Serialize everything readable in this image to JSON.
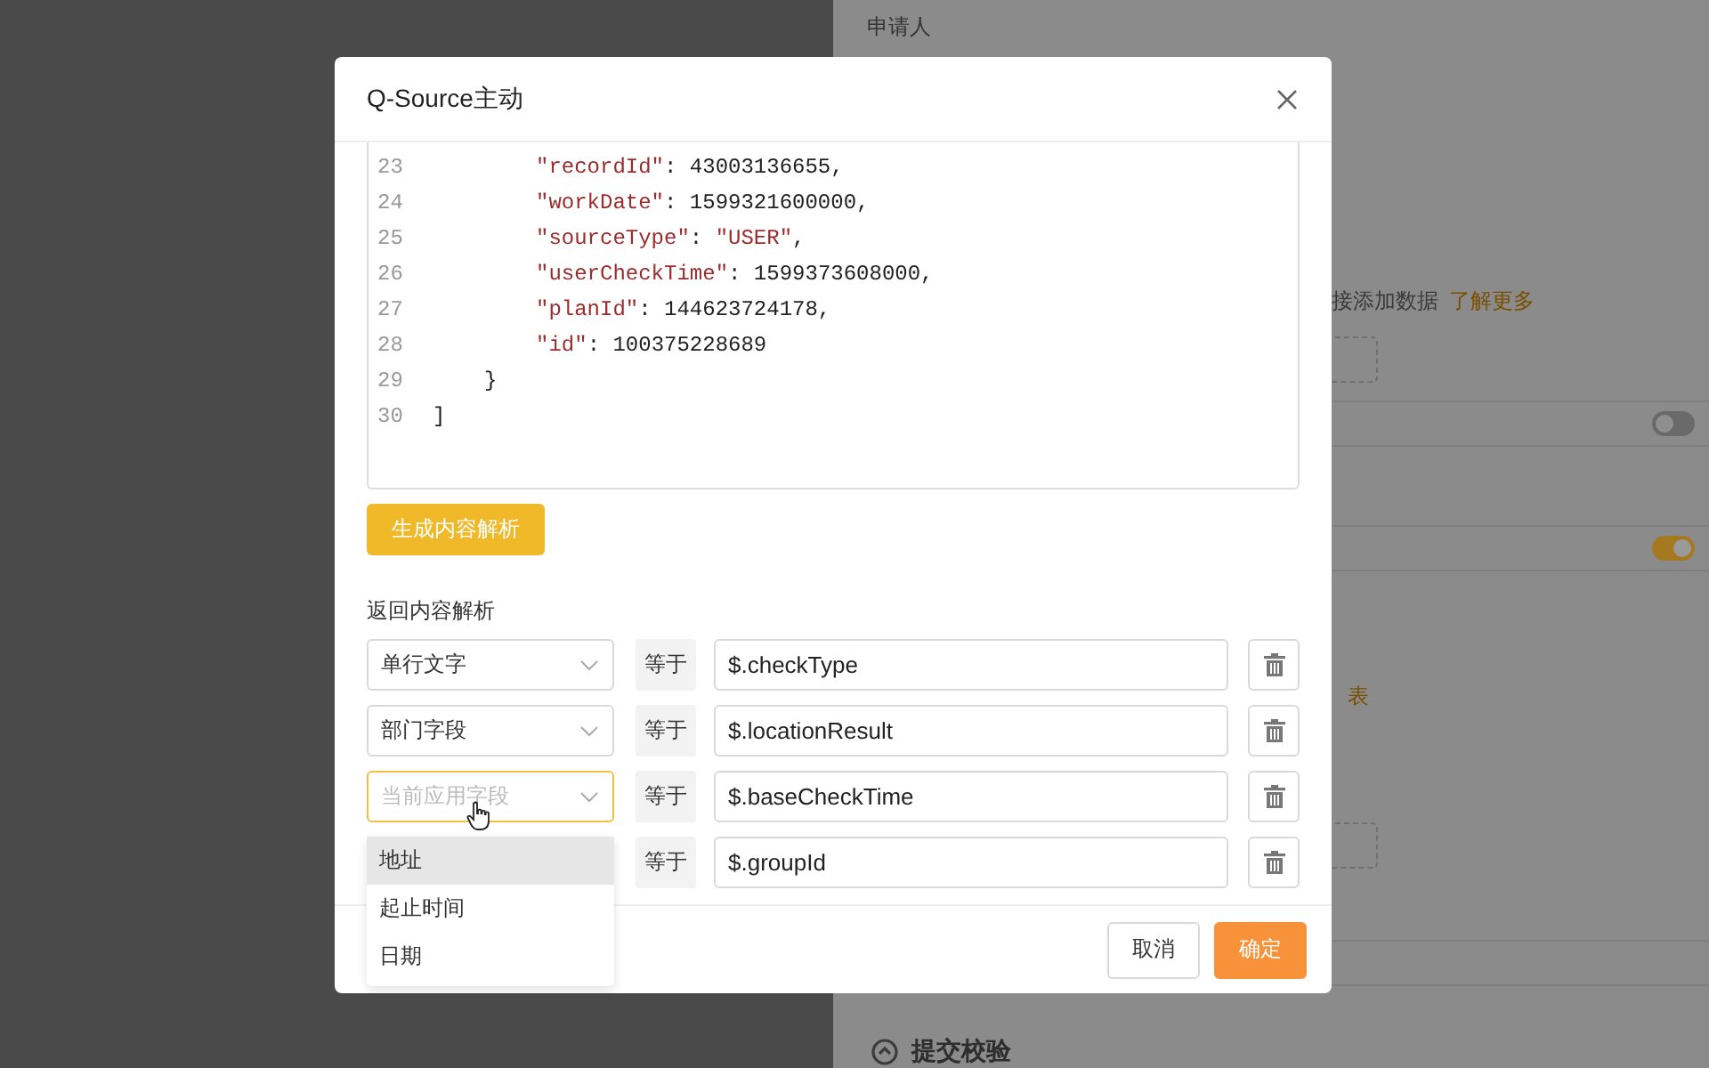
{
  "background_page": {
    "applicant_label": "申请人",
    "hint_text": "接添加数据",
    "learn_more_link": "了解更多",
    "toggles": [
      {
        "on": false
      },
      {
        "on": true
      }
    ],
    "report_link": "表",
    "section_title": "提交校验"
  },
  "dialog": {
    "title": "Q-Source主动",
    "code_lines": [
      {
        "number": "23",
        "kind": "pair",
        "tokens": [
          {
            "text": "\"recordId\"",
            "kind": "string"
          },
          {
            "text": ": 43003136655,",
            "kind": "plain"
          }
        ]
      },
      {
        "number": "24",
        "kind": "pair",
        "tokens": [
          {
            "text": "\"workDate\"",
            "kind": "string"
          },
          {
            "text": ": 1599321600000,",
            "kind": "plain"
          }
        ]
      },
      {
        "number": "25",
        "kind": "pair",
        "tokens": [
          {
            "text": "\"sourceType\"",
            "kind": "string"
          },
          {
            "text": ": ",
            "kind": "plain"
          },
          {
            "text": "\"USER\"",
            "kind": "string"
          },
          {
            "text": ",",
            "kind": "plain"
          }
        ]
      },
      {
        "number": "26",
        "kind": "pair",
        "tokens": [
          {
            "text": "\"userCheckTime\"",
            "kind": "string"
          },
          {
            "text": ": 1599373608000,",
            "kind": "plain"
          }
        ]
      },
      {
        "number": "27",
        "kind": "pair",
        "tokens": [
          {
            "text": "\"planId\"",
            "kind": "string"
          },
          {
            "text": ": 144623724178,",
            "kind": "plain"
          }
        ]
      },
      {
        "number": "28",
        "kind": "pair",
        "tokens": [
          {
            "text": "\"id\"",
            "kind": "string"
          },
          {
            "text": ": 100375228689",
            "kind": "plain"
          }
        ]
      },
      {
        "number": "29",
        "kind": "object_end",
        "tokens": [
          {
            "text": "}",
            "kind": "plain"
          }
        ]
      },
      {
        "number": "30",
        "kind": "array_end",
        "tokens": [
          {
            "text": "]",
            "kind": "plain"
          }
        ]
      }
    ],
    "generate_button": "生成内容解析",
    "section_label": "返回内容解析",
    "mappings": [
      {
        "field": "单行文字",
        "focused": false,
        "operator": "等于",
        "path": "$.checkType"
      },
      {
        "field": "部门字段",
        "focused": false,
        "operator": "等于",
        "path": "$.locationResult"
      },
      {
        "placeholder": "当前应用字段",
        "focused": true,
        "operator": "等于",
        "path": "$.baseCheckTime"
      },
      {
        "operator": "等于",
        "path": "$.groupId"
      }
    ],
    "dropdown_options": [
      {
        "label": "地址",
        "highlighted": true
      },
      {
        "label": "起止时间",
        "highlighted": false
      },
      {
        "label": "日期",
        "highlighted": false
      }
    ],
    "cancel_button": "取消",
    "ok_button": "确定"
  }
}
